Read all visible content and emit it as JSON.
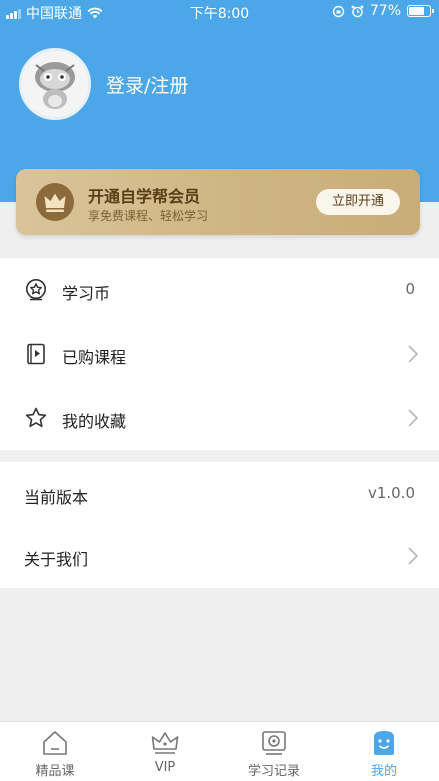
{
  "status_bar": {
    "carrier": "中国联通",
    "time": "下午8:00",
    "battery": "77%"
  },
  "profile": {
    "login_label": "登录/注册"
  },
  "vip_card": {
    "title": "开通自学帮会员",
    "subtitle": "享免费课程、轻松学习",
    "button": "立即开通"
  },
  "menu_primary": [
    {
      "label": "学习币",
      "value": "0",
      "icon": "coin-star-icon"
    },
    {
      "label": "已购课程",
      "icon": "video-book-icon"
    },
    {
      "label": "我的收藏",
      "icon": "star-icon"
    }
  ],
  "menu_secondary": [
    {
      "label": "当前版本",
      "value": "v1.0.0"
    },
    {
      "label": "关于我们"
    }
  ],
  "tabs": [
    {
      "label": "精品课",
      "icon": "house-icon"
    },
    {
      "label": "VIP",
      "icon": "crown-icon"
    },
    {
      "label": "学习记录",
      "icon": "record-icon"
    },
    {
      "label": "我的",
      "icon": "face-icon",
      "active": true
    }
  ],
  "colors": {
    "accent": "#4ba7e8",
    "vip_gold": "#cfb583",
    "vip_brown": "#5a3d17",
    "background": "#efefef"
  }
}
